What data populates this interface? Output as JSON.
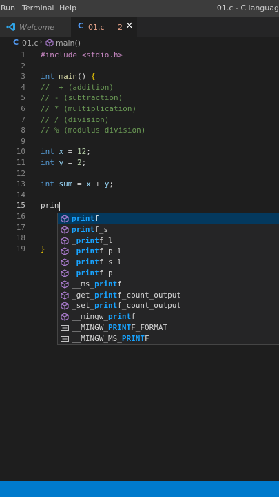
{
  "menubar": {
    "items": [
      "Run",
      "Terminal",
      "Help"
    ],
    "title": "01.c - C languag"
  },
  "tabs": [
    {
      "icon": "vscode-logo-icon",
      "label": "Welcome"
    },
    {
      "icon": "c-file-icon",
      "label": "01.c",
      "problems": "2",
      "close": "×"
    }
  ],
  "breadcrumb": {
    "file": "01.c",
    "separator": "›",
    "symbol": "main()"
  },
  "editor": {
    "lines": [
      {
        "n": "1",
        "tokens": [
          [
            "pp",
            "#include "
          ],
          [
            "str",
            "<stdio.h>"
          ]
        ]
      },
      {
        "n": "2",
        "tokens": []
      },
      {
        "n": "3",
        "tokens": [
          [
            "kw",
            "int "
          ],
          [
            "fn",
            "main"
          ],
          [
            "plain",
            "() "
          ],
          [
            "brace",
            "{"
          ]
        ]
      },
      {
        "n": "4",
        "tokens": [
          [
            "cmt",
            "//  + (addition)"
          ]
        ]
      },
      {
        "n": "5",
        "tokens": [
          [
            "cmt",
            "// - (subtraction)"
          ]
        ]
      },
      {
        "n": "6",
        "tokens": [
          [
            "cmt",
            "// * (multiplication)"
          ]
        ]
      },
      {
        "n": "7",
        "tokens": [
          [
            "cmt",
            "// / (division)"
          ]
        ]
      },
      {
        "n": "8",
        "tokens": [
          [
            "cmt",
            "// % (modulus division)"
          ]
        ]
      },
      {
        "n": "9",
        "tokens": []
      },
      {
        "n": "10",
        "tokens": [
          [
            "kw",
            "int "
          ],
          [
            "var",
            "x"
          ],
          [
            "plain",
            " = "
          ],
          [
            "num",
            "12"
          ],
          [
            "plain",
            ";"
          ]
        ]
      },
      {
        "n": "11",
        "tokens": [
          [
            "kw",
            "int "
          ],
          [
            "var",
            "y"
          ],
          [
            "plain",
            " = "
          ],
          [
            "num",
            "2"
          ],
          [
            "plain",
            ";"
          ]
        ]
      },
      {
        "n": "12",
        "tokens": []
      },
      {
        "n": "13",
        "tokens": [
          [
            "kw",
            "int "
          ],
          [
            "var",
            "sum"
          ],
          [
            "plain",
            " = "
          ],
          [
            "var",
            "x"
          ],
          [
            "plain",
            " + "
          ],
          [
            "var",
            "y"
          ],
          [
            "plain",
            ";"
          ]
        ]
      },
      {
        "n": "14",
        "tokens": []
      },
      {
        "n": "15",
        "tokens": [
          [
            "plain",
            "prin"
          ]
        ]
      },
      {
        "n": "16",
        "tokens": []
      },
      {
        "n": "17",
        "tokens": []
      },
      {
        "n": "18",
        "tokens": []
      },
      {
        "n": "19",
        "tokens": [
          [
            "brace",
            "}"
          ]
        ]
      }
    ]
  },
  "suggestions": [
    {
      "icon": "cube-icon",
      "pre": "",
      "match": "print",
      "post": "f",
      "selected": true
    },
    {
      "icon": "cube-icon",
      "pre": "",
      "match": "print",
      "post": "f_s"
    },
    {
      "icon": "cube-icon",
      "pre": "_",
      "match": "print",
      "post": "f_l"
    },
    {
      "icon": "cube-icon",
      "pre": "_",
      "match": "print",
      "post": "f_p_l"
    },
    {
      "icon": "cube-icon",
      "pre": "_",
      "match": "print",
      "post": "f_s_l"
    },
    {
      "icon": "cube-icon",
      "pre": "_",
      "match": "print",
      "post": "f_p"
    },
    {
      "icon": "cube-icon",
      "pre": "__ms_",
      "match": "print",
      "post": "f"
    },
    {
      "icon": "cube-icon",
      "pre": "_get_",
      "match": "print",
      "post": "f_count_output"
    },
    {
      "icon": "cube-icon",
      "pre": "_set_",
      "match": "print",
      "post": "f_count_output"
    },
    {
      "icon": "cube-icon",
      "pre": "__mingw_",
      "match": "print",
      "post": "f"
    },
    {
      "icon": "text-icon",
      "pre": "__MINGW_",
      "match": "PRINT",
      "post": "F_FORMAT"
    },
    {
      "icon": "text-icon",
      "pre": "__MINGW_MS_",
      "match": "PRINT",
      "post": "F"
    }
  ],
  "colors": {
    "accent": "#007acc",
    "match_highlight": "#18a3ff",
    "selection": "#04395e"
  }
}
